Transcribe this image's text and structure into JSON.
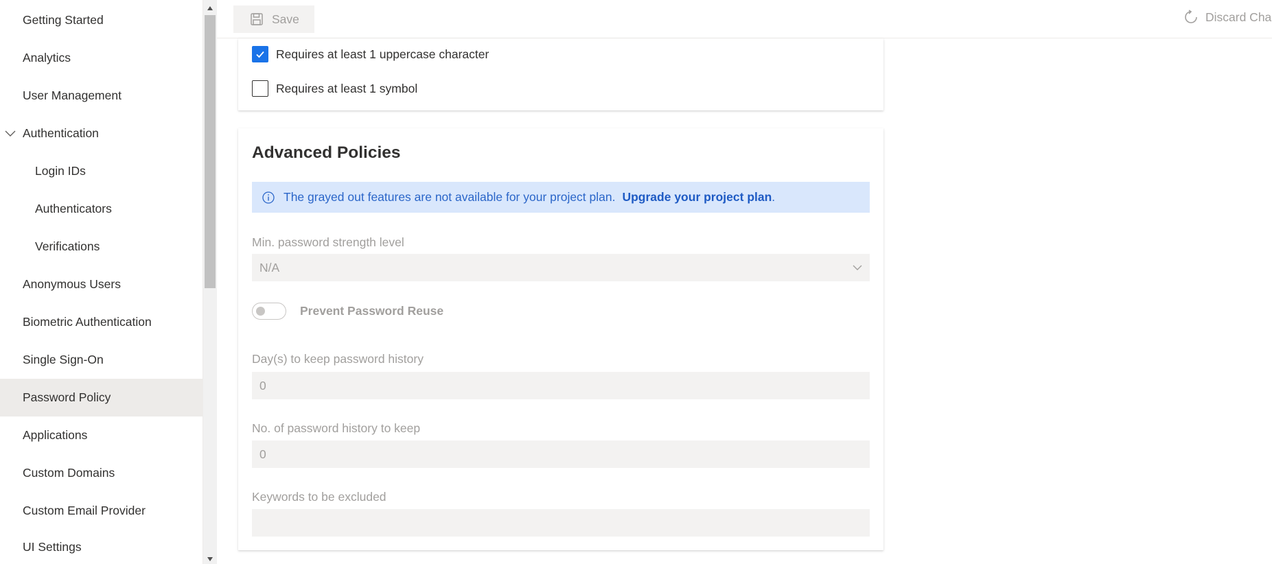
{
  "sidebar": {
    "items": [
      {
        "label": "Getting Started"
      },
      {
        "label": "Analytics"
      },
      {
        "label": "User Management"
      },
      {
        "label": "Authentication"
      },
      {
        "label": "Login IDs"
      },
      {
        "label": "Authenticators"
      },
      {
        "label": "Verifications"
      },
      {
        "label": "Anonymous Users"
      },
      {
        "label": "Biometric Authentication"
      },
      {
        "label": "Single Sign-On"
      },
      {
        "label": "Password Policy"
      },
      {
        "label": "Applications"
      },
      {
        "label": "Custom Domains"
      },
      {
        "label": "Custom Email Provider"
      },
      {
        "label": "UI Settings"
      }
    ],
    "selected": "Password Policy"
  },
  "toolbar": {
    "save_label": "Save",
    "discard_label": "Discard Changes"
  },
  "policy_checks": {
    "uppercase": {
      "label": "Requires at least 1 uppercase character",
      "checked": true
    },
    "symbol": {
      "label": "Requires at least 1 symbol",
      "checked": false
    }
  },
  "advanced": {
    "title": "Advanced Policies",
    "info_text": "The grayed out features are not available for your project plan.",
    "info_link": "Upgrade your project plan",
    "info_suffix": ".",
    "strength_label": "Min. password strength level",
    "strength_value": "N/A",
    "reuse_label": "Prevent Password Reuse",
    "history_days_label": "Day(s) to keep password history",
    "history_days_value": "0",
    "history_count_label": "No. of password history to keep",
    "history_count_value": "0",
    "keywords_label": "Keywords to be excluded",
    "keywords_value": ""
  },
  "colors": {
    "accent": "#1a73e8",
    "info_bg": "#d9e7fc",
    "disabled_text": "#a19f9d",
    "selected_bg": "#edebe9"
  }
}
